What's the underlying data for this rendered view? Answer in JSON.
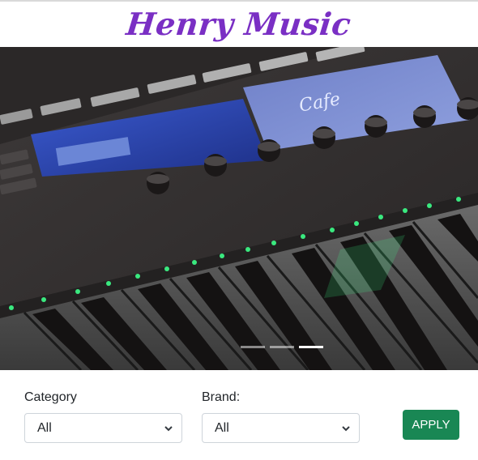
{
  "header": {
    "brand": "Henry Music"
  },
  "hero": {
    "image": "synthesizer keyboard photo",
    "slides": 3,
    "active_slide": 3
  },
  "filters": {
    "category": {
      "label": "Category",
      "selected": "All"
    },
    "brand": {
      "label": "Brand:",
      "selected": "All"
    },
    "apply_label": "APPLY"
  },
  "colors": {
    "brand_purple": "#7a2fc4",
    "apply_green": "#198754",
    "key_glow": "#3dff8a"
  },
  "icons": {
    "select_chevron": "chevron-down-icon"
  }
}
